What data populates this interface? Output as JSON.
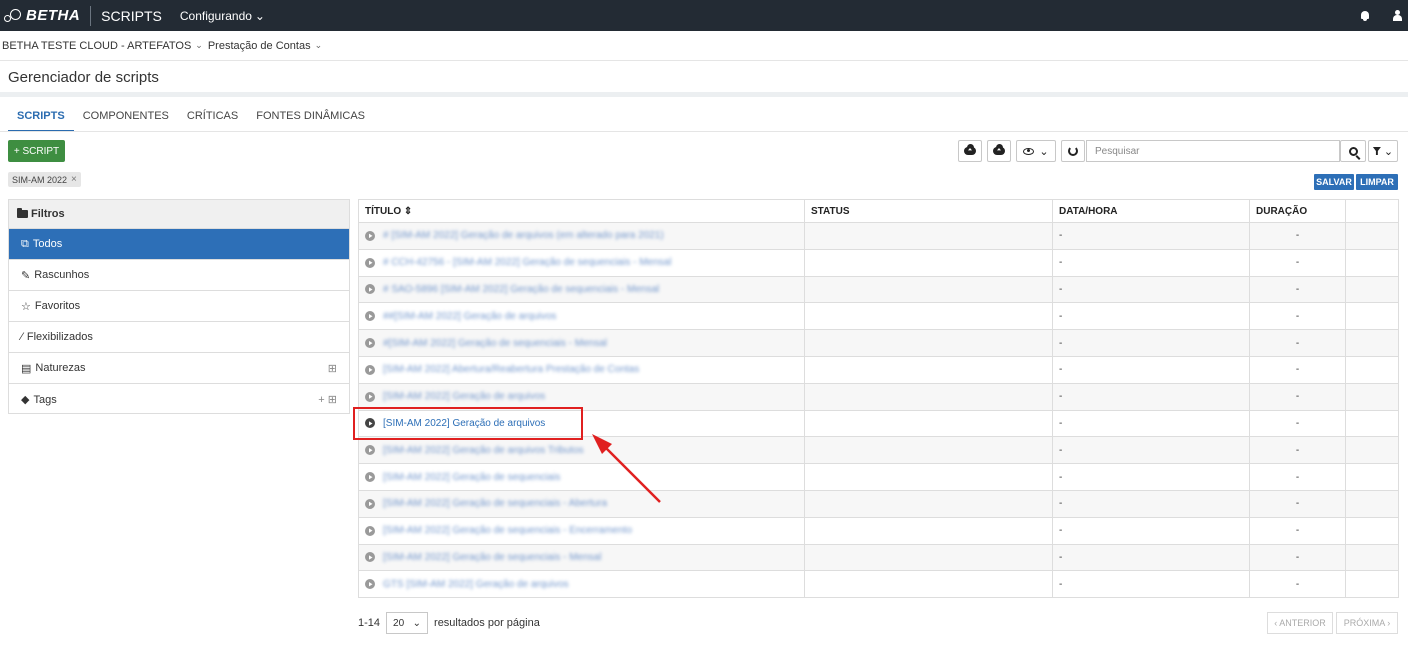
{
  "topbar": {
    "brand": "BETHA",
    "app_name": "SCRIPTS",
    "status_menu": "Configurando",
    "status_chevron": "⌄",
    "icons": [
      "bell-icon",
      "user-icon"
    ]
  },
  "context": {
    "entity": "BETHA TESTE CLOUD - ARTEFATOS",
    "module": "Prestação de Contas",
    "chevron": "⌄"
  },
  "page": {
    "title": "Gerenciador de scripts"
  },
  "tabs": [
    {
      "label": "SCRIPTS",
      "active": true
    },
    {
      "label": "COMPONENTES",
      "active": false
    },
    {
      "label": "CRÍTICAS",
      "active": false
    },
    {
      "label": "FONTES DINÂMICAS",
      "active": false
    }
  ],
  "toolbar": {
    "add_label": "+ SCRIPT",
    "filter_chip": "SIM-AM 2022",
    "chip_close": "×",
    "search_placeholder": "Pesquisar",
    "eye_chevron": "⌄",
    "filter_chevron": "⌄",
    "save_label": "SALVAR",
    "clear_label": "LIMPAR"
  },
  "sidebar": {
    "header": "Filtros",
    "items": [
      {
        "label": "Todos",
        "icon": "⧉",
        "active": true,
        "extra": ""
      },
      {
        "label": "Rascunhos",
        "icon": "✎",
        "active": false,
        "extra": ""
      },
      {
        "label": "Favoritos",
        "icon": "☆",
        "active": false,
        "extra": ""
      },
      {
        "label": "Flexibilizados",
        "icon": "⁄",
        "active": false,
        "extra": ""
      },
      {
        "label": "Naturezas",
        "icon": "▤",
        "active": false,
        "extra": "⊞"
      },
      {
        "label": "Tags",
        "icon": "◆",
        "active": false,
        "extra": "+ ⊞"
      }
    ]
  },
  "table": {
    "headers": {
      "title": "TÍTULO",
      "sort": "⇕",
      "status": "STATUS",
      "datetime": "DATA/HORA",
      "duration": "DURAÇÃO"
    },
    "rows": [
      {
        "title": "# [SIM-AM 2022] Geração de arquivos (em alterado para 2021)",
        "status": "",
        "datetime": "-",
        "duration": "-",
        "blurred": true
      },
      {
        "title": "# CCH-42756 - [SIM-AM 2022] Geração de sequenciais - Mensal",
        "status": "",
        "datetime": "-",
        "duration": "-",
        "blurred": true
      },
      {
        "title": "# SAO-5896 [SIM-AM 2022] Geração de sequenciais - Mensal",
        "status": "",
        "datetime": "-",
        "duration": "-",
        "blurred": true
      },
      {
        "title": "##[SIM-AM 2022] Geração de arquivos",
        "status": "",
        "datetime": "-",
        "duration": "-",
        "blurred": true
      },
      {
        "title": "#[SIM-AM 2022] Geração de sequenciais - Mensal",
        "status": "",
        "datetime": "-",
        "duration": "-",
        "blurred": true
      },
      {
        "title": "[SIM-AM 2022] Abertura/Reabertura Prestação de Contas",
        "status": "",
        "datetime": "-",
        "duration": "-",
        "blurred": true
      },
      {
        "title": "[SIM-AM 2022] Geração de arquivos",
        "status": "",
        "datetime": "-",
        "duration": "-",
        "blurred": true
      },
      {
        "title": "[SIM-AM 2022] Geração de arquivos",
        "status": "",
        "datetime": "-",
        "duration": "-",
        "blurred": false
      },
      {
        "title": "[SIM-AM 2022] Geração de arquivos Tributos",
        "status": "",
        "datetime": "-",
        "duration": "-",
        "blurred": true
      },
      {
        "title": "[SIM-AM 2022] Geração de sequenciais",
        "status": "",
        "datetime": "-",
        "duration": "-",
        "blurred": true
      },
      {
        "title": "[SIM-AM 2022] Geração de sequenciais - Abertura",
        "status": "",
        "datetime": "-",
        "duration": "-",
        "blurred": true
      },
      {
        "title": "[SIM-AM 2022] Geração de sequenciais - Encerramento",
        "status": "",
        "datetime": "-",
        "duration": "-",
        "blurred": true
      },
      {
        "title": "[SIM-AM 2022] Geração de sequenciais - Mensal",
        "status": "",
        "datetime": "-",
        "duration": "-",
        "blurred": true
      },
      {
        "title": "GTS [SIM-AM 2022] Geração de arquivos",
        "status": "",
        "datetime": "-",
        "duration": "-",
        "blurred": true
      }
    ]
  },
  "pagination": {
    "range": "1-14",
    "per_page": "20",
    "per_page_chevron": "⌄",
    "per_page_label": "resultados por página",
    "prev_label": "‹ ANTERIOR",
    "next_label": "PRÓXIMA ›"
  },
  "colors": {
    "topbar": "#232b34",
    "accent": "#2d6fb7",
    "add_button": "#3e8e41",
    "highlight": "#e02020"
  }
}
